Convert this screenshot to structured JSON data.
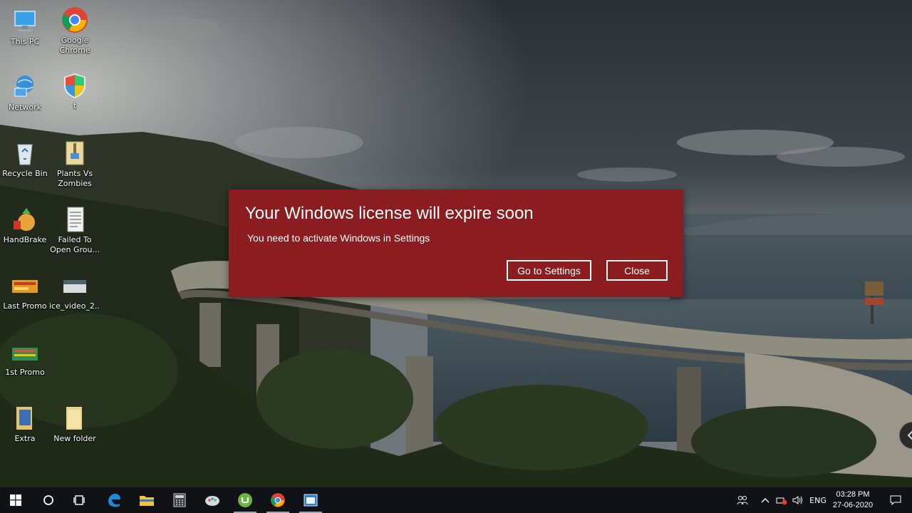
{
  "desktop": {
    "icons": [
      {
        "label": "This PC",
        "icon": "this-pc-icon"
      },
      {
        "label": "Google Chrome",
        "line1": "Google",
        "line2": "Chrome",
        "icon": "chrome-icon"
      },
      {
        "label": "Network",
        "icon": "network-icon"
      },
      {
        "label": "t",
        "icon": "shield-icon"
      },
      {
        "label": "Recycle Bin",
        "icon": "recycle-bin-icon"
      },
      {
        "label": "Plants Vs Zombies",
        "line1": "Plants Vs",
        "line2": "Zombies",
        "icon": "archive-icon"
      },
      {
        "label": "HandBrake",
        "icon": "handbrake-icon"
      },
      {
        "label": "Failed To Open Grou...",
        "line1": "Failed To",
        "line2": "Open Grou...",
        "icon": "text-file-icon"
      },
      {
        "label": "Last Promo",
        "icon": "image-file-icon"
      },
      {
        "label": "ice_video_2...",
        "icon": "video-file-icon"
      },
      {
        "label": "1st Promo",
        "icon": "image-file-icon"
      },
      {
        "label": "Extra",
        "icon": "folder-icon"
      },
      {
        "label": "New folder",
        "icon": "folder-icon"
      }
    ]
  },
  "dialog": {
    "title": "Your Windows license will expire soon",
    "message": "You need to activate Windows in Settings",
    "settings_button": "Go to Settings",
    "close_button": "Close",
    "background_color": "#8b1c1f"
  },
  "taskbar": {
    "items": [
      "start-icon",
      "search-circle-icon",
      "task-view-icon",
      "edge-icon",
      "file-explorer-icon",
      "calculator-icon",
      "paint-icon",
      "utorrent-icon",
      "chrome-icon",
      "window-app-icon"
    ],
    "tray": {
      "language": "ENG",
      "time": "03:28 PM",
      "date": "27-06-2020"
    }
  },
  "colors": {
    "taskbar": "#101215",
    "dialog": "#8b1c1f"
  }
}
